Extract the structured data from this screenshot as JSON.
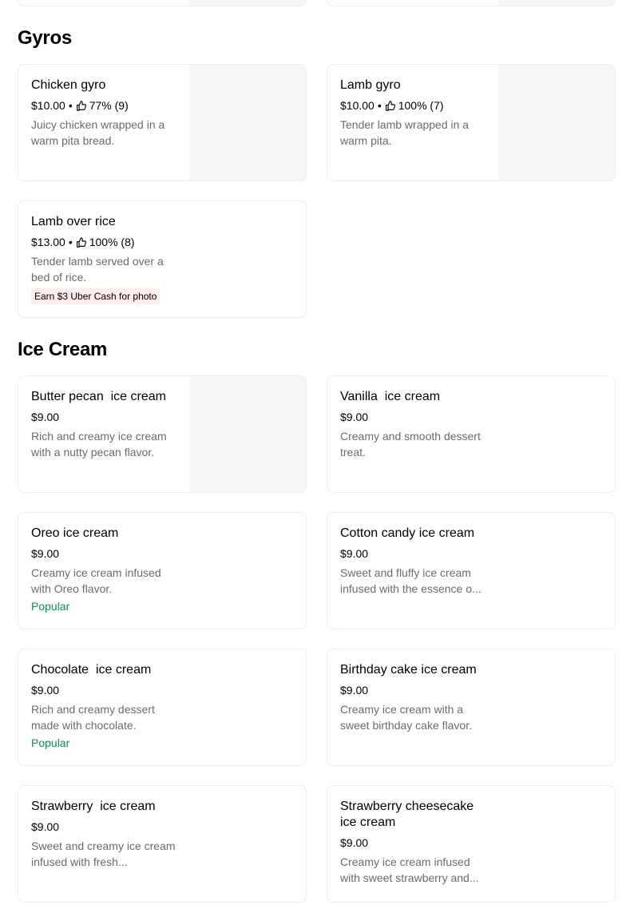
{
  "sections": [
    {
      "title": "Gyros",
      "items": [
        {
          "name": "Chicken gyro",
          "price": "$10.00",
          "sep": "•",
          "rating": "77% (9)",
          "desc": "Juicy chicken wrapped in a warm pita bread."
        },
        {
          "name": "Lamb gyro",
          "price": "$10.00",
          "sep": "•",
          "rating": "100% (7)",
          "desc": "Tender lamb wrapped in a warm pita."
        },
        {
          "name": "Lamb over rice",
          "price": "$13.00",
          "sep": "•",
          "rating": "100% (8)",
          "desc": "Tender lamb served over a bed of rice.",
          "badge": "Earn $3 Uber Cash for photo"
        }
      ]
    },
    {
      "title": "Ice Cream",
      "items": [
        {
          "name": "Butter pecan  ice cream",
          "price": "$9.00",
          "desc": "Rich and creamy ice cream with a nutty pecan flavor."
        },
        {
          "name": "Vanilla  ice cream",
          "price": "$9.00",
          "desc": "Creamy and smooth dessert treat."
        },
        {
          "name": "Oreo ice cream",
          "price": "$9.00",
          "desc": "Creamy ice cream infused with Oreo flavor.",
          "tag": "Popular"
        },
        {
          "name": "Cotton candy ice cream",
          "price": "$9.00",
          "desc": "Sweet and fluffy ice cream infused with the essence o..."
        },
        {
          "name": "Chocolate  ice cream",
          "price": "$9.00",
          "desc": "Rich and creamy dessert made with chocolate.",
          "tag": "Popular"
        },
        {
          "name": "Birthday cake ice cream",
          "price": "$9.00",
          "desc": "Creamy ice cream with a sweet birthday cake flavor."
        },
        {
          "name": "Strawberry  ice cream",
          "price": "$9.00",
          "desc": "Sweet and creamy ice cream infused with fresh..."
        },
        {
          "name": "Strawberry cheesecake ice cream",
          "price": "$9.00",
          "desc": "Creamy ice cream infused with sweet strawberry and..."
        }
      ]
    }
  ],
  "colors": {
    "popular": "#05944f",
    "badge_bg": "#fdecea",
    "desc": "#6b6b6b",
    "thumb_bg": "#f6f6f6"
  },
  "icons": {
    "rating": "thumbs-up-icon"
  }
}
